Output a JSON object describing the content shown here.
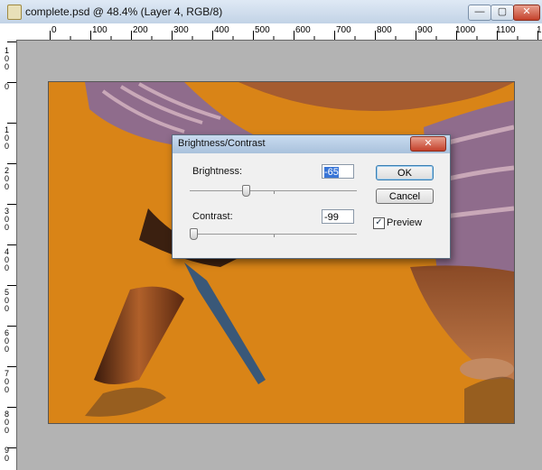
{
  "window": {
    "title": "complete.psd @ 48.4% (Layer 4, RGB/8)",
    "min_glyph": "—",
    "max_glyph": "▢",
    "close_glyph": "✕"
  },
  "ruler": {
    "h_labels": [
      "0",
      "100",
      "200",
      "300",
      "400",
      "500",
      "600",
      "700",
      "800",
      "900",
      "1000",
      "1100",
      "1"
    ],
    "v_labels": [
      "100",
      "0",
      "100",
      "200",
      "300",
      "400",
      "500",
      "600",
      "700",
      "800",
      "90"
    ]
  },
  "dialog": {
    "title": "Brightness/Contrast",
    "close_glyph": "✕",
    "brightness_label": "Brightness:",
    "brightness_value": "-65",
    "contrast_label": "Contrast:",
    "contrast_value": "-99",
    "ok_label": "OK",
    "cancel_label": "Cancel",
    "preview_label": "Preview",
    "preview_checked": true,
    "brightness_slider_fraction": 0.24,
    "contrast_slider_fraction": 0.005
  },
  "colors": {
    "canvas_bg": "#d98417",
    "dialog_bg": "#f0f0f0"
  }
}
